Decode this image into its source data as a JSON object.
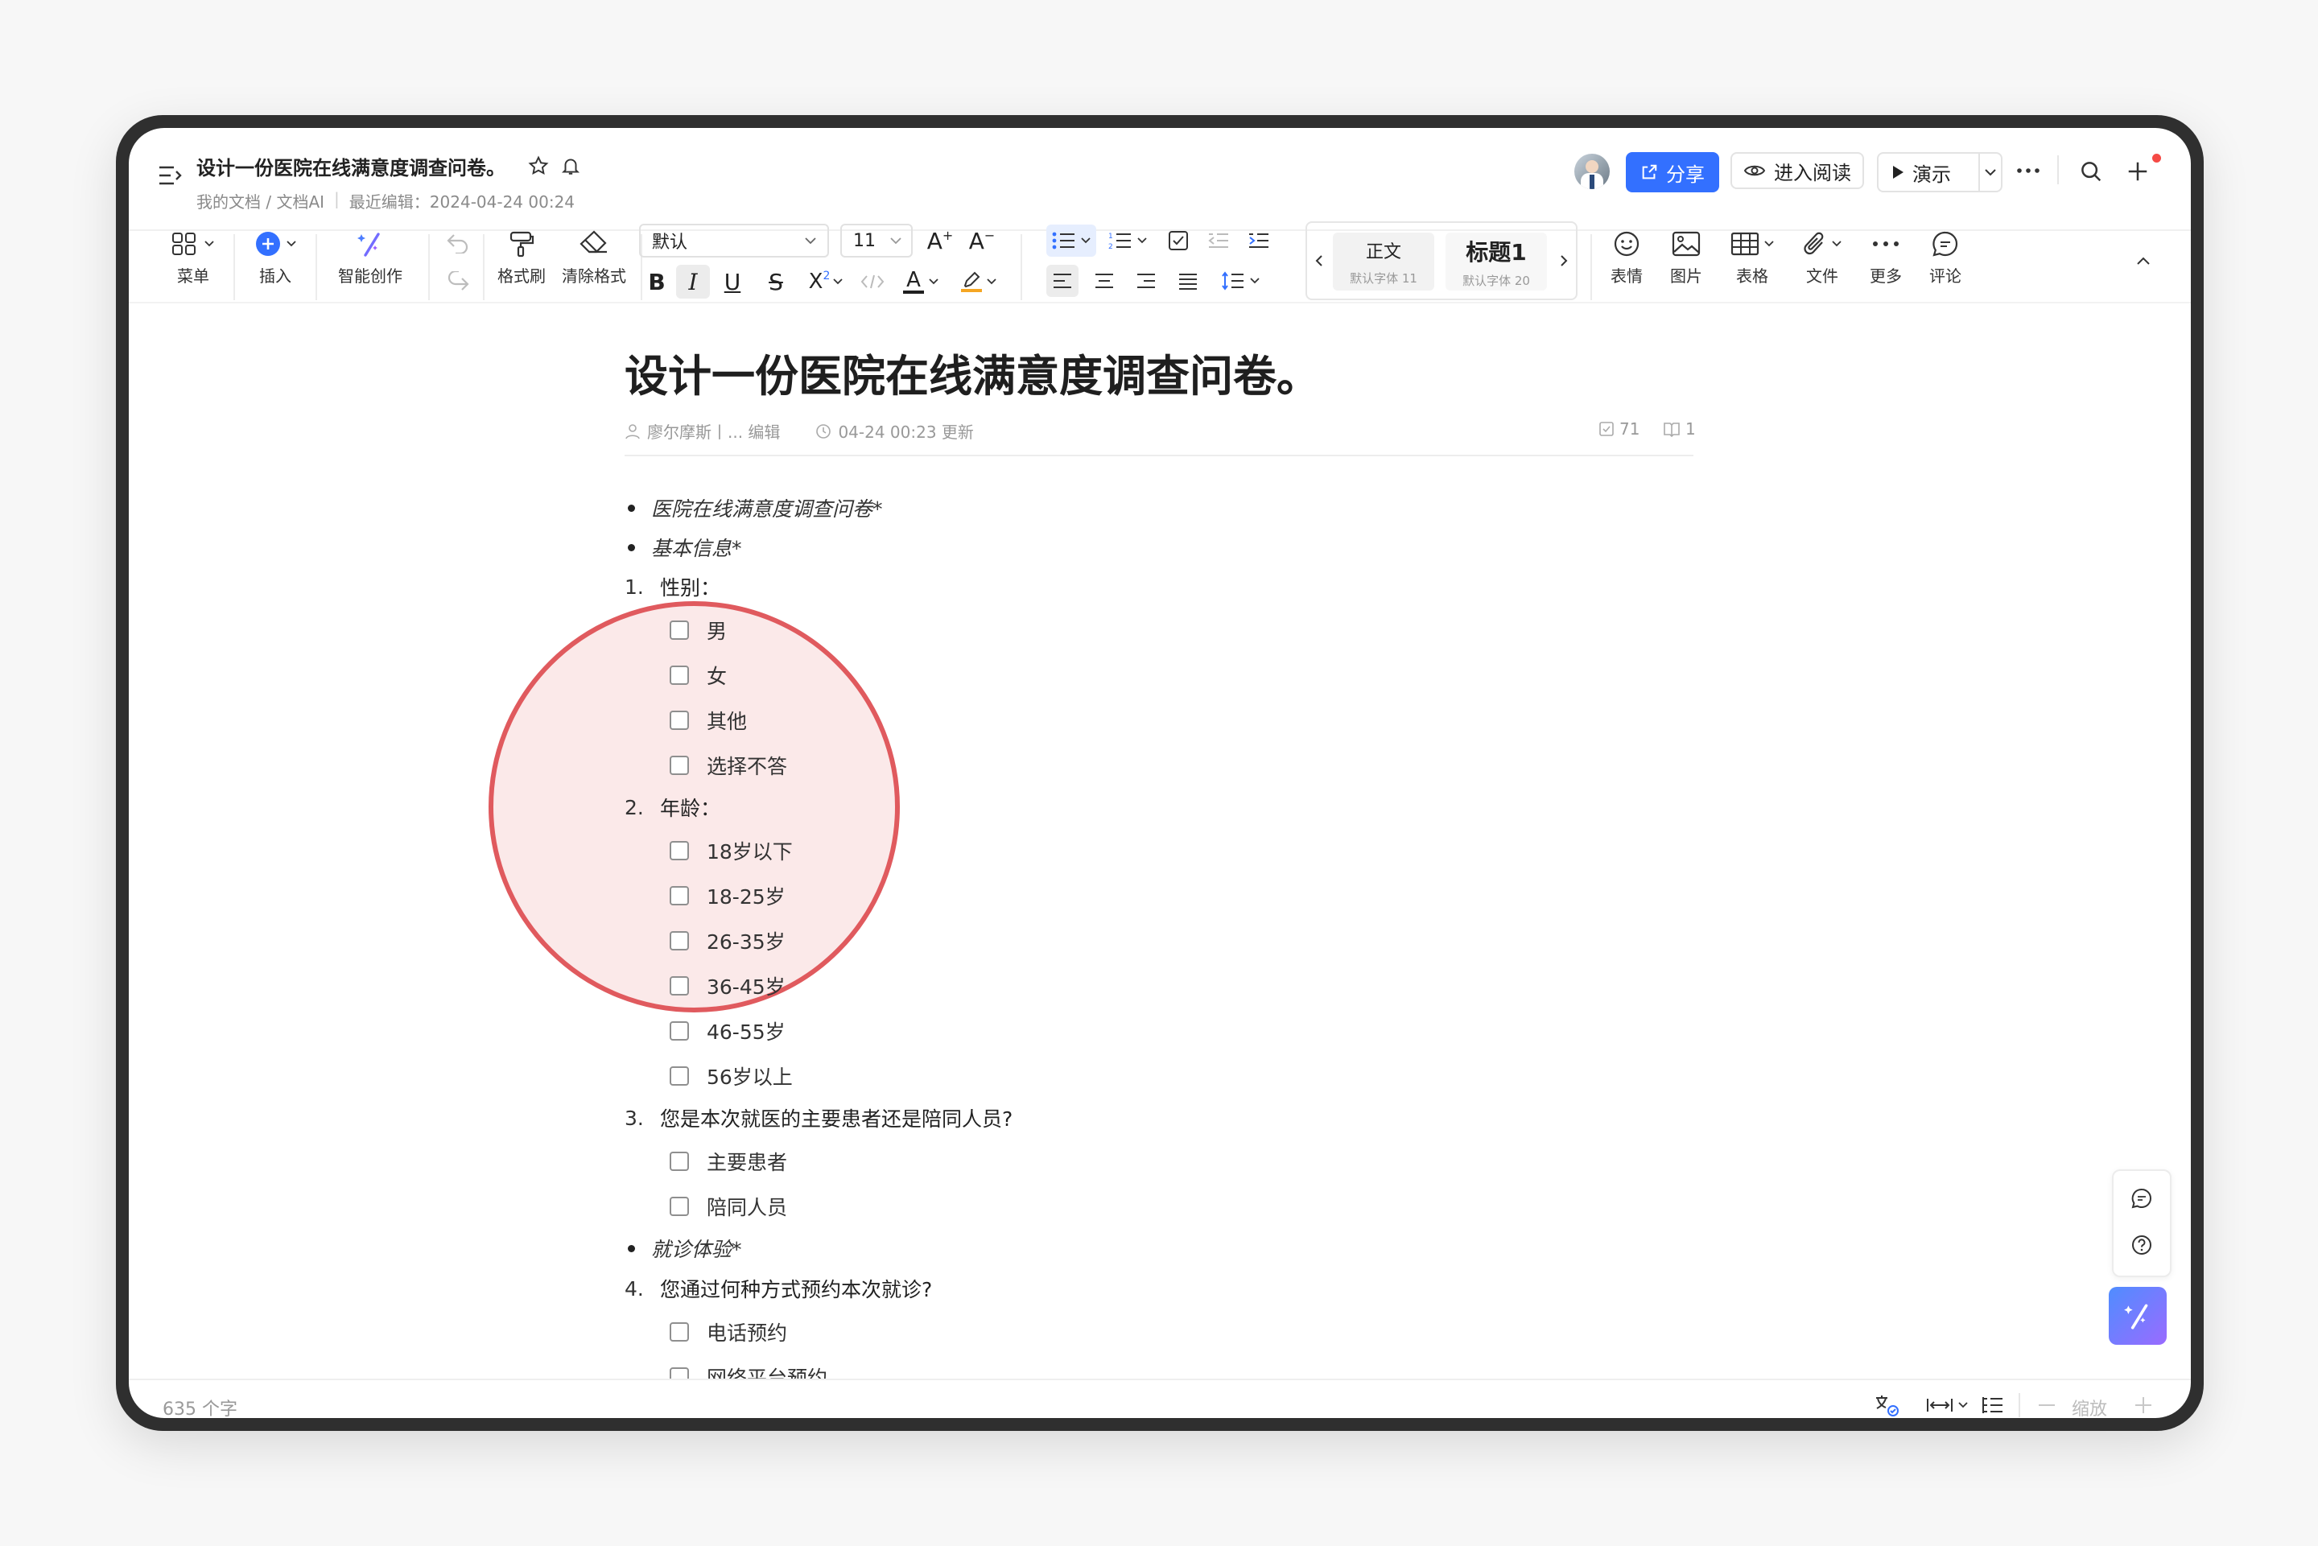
{
  "header": {
    "doc_title": "设计一份医院在线满意度调查问卷。",
    "breadcrumb": "我的文档 / 文档AI",
    "last_edit": "最近编辑：2024-04-24 00:24",
    "share_label": "分享",
    "read_label": "进入阅读",
    "present_label": "演示"
  },
  "toolbar": {
    "menu": "菜单",
    "insert": "插入",
    "ai_create": "智能创作",
    "format_painter": "格式刷",
    "clear_format": "清除格式",
    "font_family": "默认",
    "font_size": "11",
    "style_normal": "正文",
    "style_normal_sub": "默认字体 11",
    "style_h1": "标题1",
    "style_h1_sub": "默认字体 20",
    "emoji": "表情",
    "image": "图片",
    "table": "表格",
    "file": "文件",
    "more": "更多",
    "comment": "评论"
  },
  "doc": {
    "title": "设计一份医院在线满意度调查问卷。",
    "author": "廖尔摩斯丨... 编辑",
    "updated": "04-24 00:23 更新",
    "checks": "71",
    "reads": "1",
    "bullets": [
      "医院在线满意度调查问卷*",
      "基本信息*",
      "就诊体验*"
    ],
    "q1": "性别：",
    "q1_options": [
      "男",
      "女",
      "其他",
      "选择不答"
    ],
    "q2": "年龄：",
    "q2_options": [
      "18岁以下",
      "18-25岁",
      "26-35岁",
      "36-45岁",
      "46-55岁",
      "56岁以上"
    ],
    "q3": "您是本次就医的主要患者还是陪同人员?",
    "q3_options": [
      "主要患者",
      "陪同人员"
    ],
    "q4": "您通过何种方式预约本次就诊?",
    "q4_options": [
      "电话预约",
      "网络平台预约"
    ],
    "numbers": [
      "1.",
      "2.",
      "3.",
      "4."
    ]
  },
  "status": {
    "word_count": "635 个字",
    "zoom_label": "缩放"
  },
  "colors": {
    "accent": "#3370ff",
    "highlight_ring": "#e05a5e",
    "highlight_fill": "#fbe9e9",
    "ai_button": "#6f7dff"
  }
}
